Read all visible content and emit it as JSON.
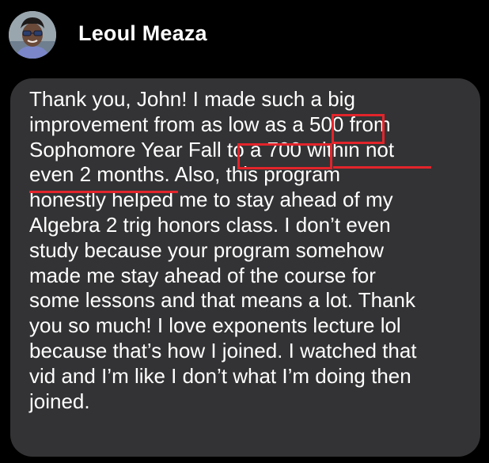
{
  "sender": {
    "name": "Leoul Meaza"
  },
  "message": {
    "lines": [
      "Thank you, John! I made such a big",
      "improvement from as low as a 500 from",
      "Sophomore Year Fall to a 700 within not",
      "even 2 months. Also, this program",
      "honestly helped me to stay ahead of my",
      "Algebra 2 trig honors class. I don’t even",
      "study because your program somehow",
      "made me stay ahead of the course for",
      "some lessons and that means a lot. Thank",
      "you so much! I love exponents lecture lol",
      "because that’s how I joined. I watched that",
      "vid and I’m like I don’t what I’m doing then",
      "joined."
    ]
  },
  "annotations": {
    "highlight_color": "#e3242b",
    "boxed_phrases": [
      "500",
      "to a 700"
    ],
    "underlined_phrases": [
      "within not",
      "even 2 months"
    ]
  },
  "colors": {
    "background": "#000000",
    "bubble": "#333335",
    "text": "#ffffff"
  }
}
